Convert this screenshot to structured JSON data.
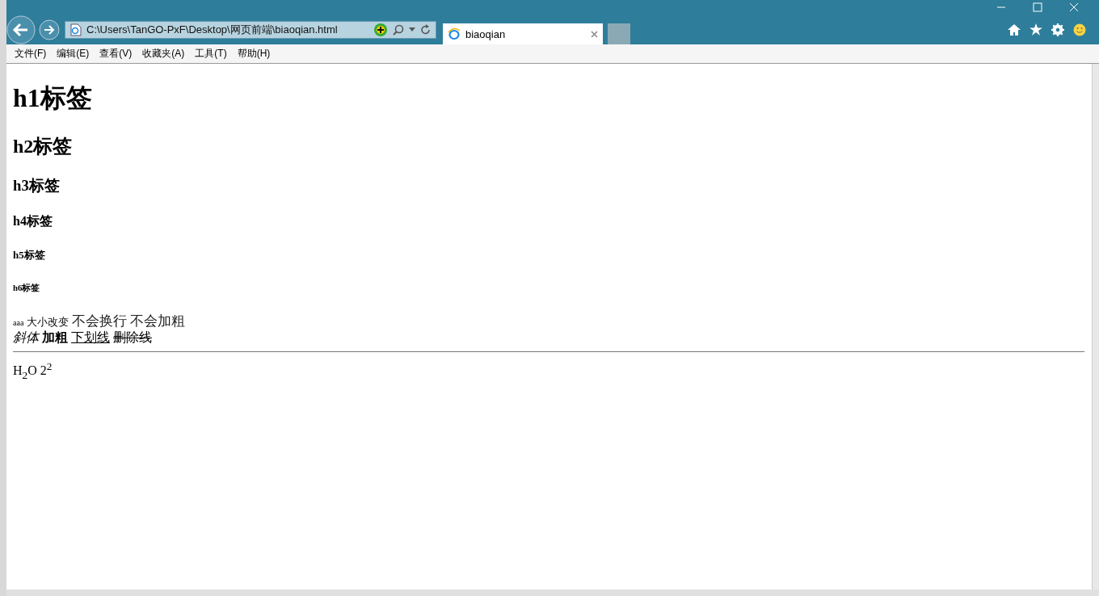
{
  "address_bar": {
    "value": "C:\\Users\\TanGO-PxF\\Desktop\\网页前端\\biaoqian.html"
  },
  "tabs": [
    {
      "label": "biaoqian",
      "selected": true
    }
  ],
  "menu": [
    "文件(F)",
    "编辑(E)",
    "查看(V)",
    "收藏夹(A)",
    "工具(T)",
    "帮助(H)"
  ],
  "headings": [
    {
      "kind": "h1",
      "text": "h1标签"
    },
    {
      "kind": "h2",
      "text": "h2标签"
    },
    {
      "kind": "h3",
      "text": "h3标签"
    },
    {
      "kind": "h4",
      "text": "h4标签"
    },
    {
      "kind": "h5",
      "text": "h5标签"
    },
    {
      "kind": "h6",
      "text": "h6标签"
    }
  ],
  "line_1": [
    {
      "kind": "tiny",
      "text": "aaa"
    },
    {
      "kind": "small",
      "text": "大小改变"
    },
    {
      "kind": "big",
      "text": "不会换行"
    },
    {
      "kind": "big",
      "text": "不会加粗"
    }
  ],
  "line_2": [
    {
      "kind": "italic",
      "text": "斜体"
    },
    {
      "kind": "bold",
      "text": "加粗"
    },
    {
      "kind": "underline",
      "text": "下划线"
    },
    {
      "kind": "strike",
      "text": "删除线"
    }
  ],
  "formula": "H$_{2}$O 2$^{2}$"
}
